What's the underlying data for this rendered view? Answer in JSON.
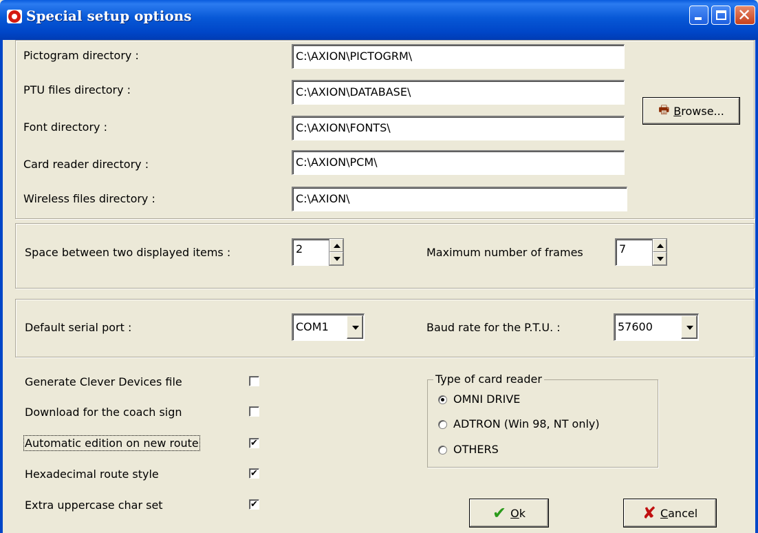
{
  "window": {
    "title": "Special setup options"
  },
  "directories": [
    {
      "label": "Pictogram directory :",
      "value": "C:\\AXION\\PICTOGRM\\"
    },
    {
      "label": "PTU files directory :",
      "value": "C:\\AXION\\DATABASE\\"
    },
    {
      "label": "Font directory :",
      "value": "C:\\AXION\\FONTS\\"
    },
    {
      "label": "Card reader directory :",
      "value": "C:\\AXION\\PCM\\"
    },
    {
      "label": "Wireless files directory :",
      "value": "C:\\AXION\\"
    }
  ],
  "browse_button": {
    "label_prefix": "",
    "label_underline": "B",
    "label_rest": "rowse..."
  },
  "spacing": {
    "space_label": "Space between two displayed items :",
    "space_value": "2",
    "frames_label": "Maximum number of frames",
    "frames_value": "7"
  },
  "serial": {
    "port_label": "Default serial port :",
    "port_value": "COM1",
    "baud_label": "Baud rate for the P.T.U. :",
    "baud_value": "57600"
  },
  "options": [
    {
      "label": "Generate Clever Devices file",
      "checked": false,
      "mark": ""
    },
    {
      "label": "Download for the coach sign",
      "checked": false,
      "mark": ""
    },
    {
      "label": "Automatic edition on new route",
      "checked": true,
      "mark": "✔"
    },
    {
      "label": "Hexadecimal route style",
      "checked": true,
      "mark": "✔"
    },
    {
      "label": "Extra uppercase char set",
      "checked": true,
      "mark": "✔"
    }
  ],
  "card_reader": {
    "title": "Type of card reader",
    "choices": [
      {
        "label": "OMNI DRIVE",
        "selected": true
      },
      {
        "label": "ADTRON (Win 98, NT only)",
        "selected": false
      },
      {
        "label": "OTHERS",
        "selected": false
      }
    ]
  },
  "buttons": {
    "ok_underline": "O",
    "ok_rest": "k",
    "cancel_underline": "C",
    "cancel_rest": "ancel"
  },
  "colors": {
    "titlebar": "#0046c8",
    "face": "#ece9d8",
    "ok_check": "#2a9a1a",
    "cancel_x": "#c01010"
  }
}
